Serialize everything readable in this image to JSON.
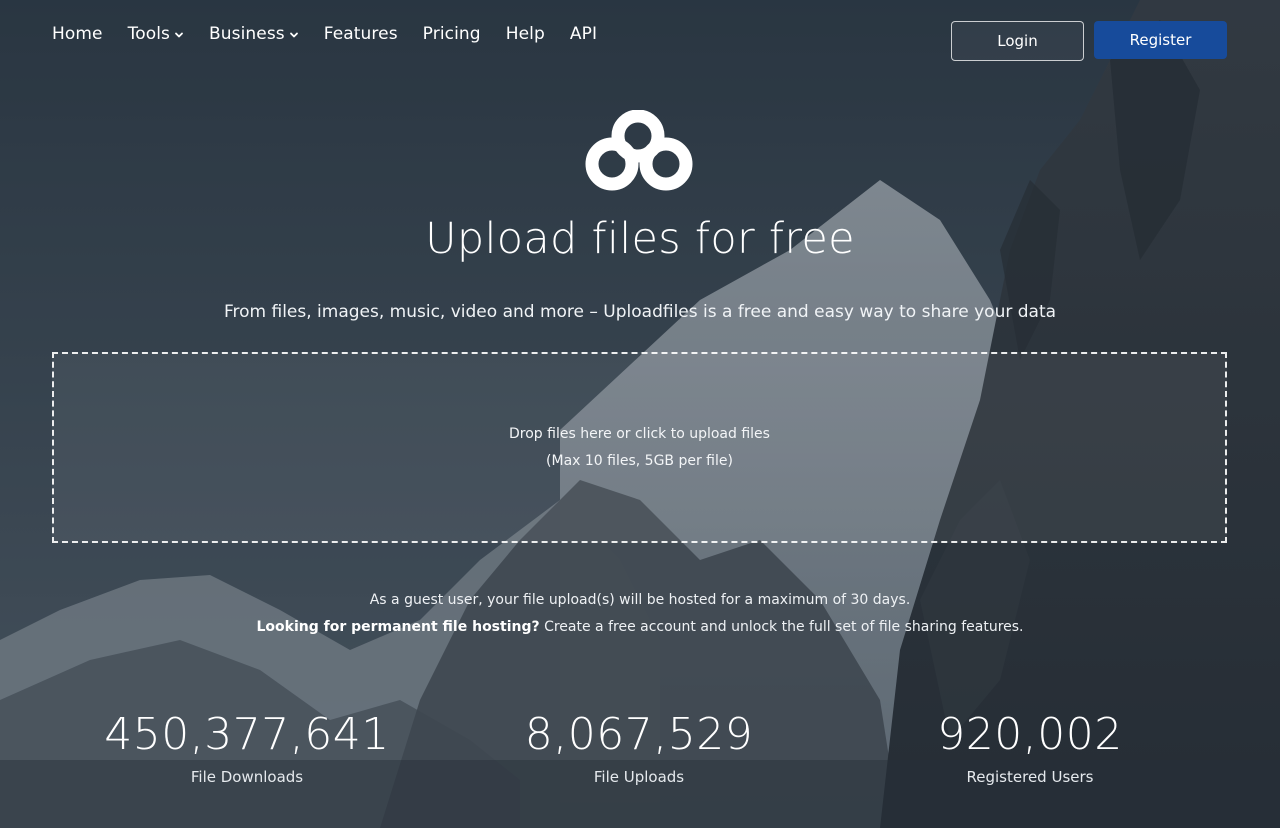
{
  "nav": {
    "items": [
      {
        "label": "Home",
        "dropdown": false
      },
      {
        "label": "Tools",
        "dropdown": true
      },
      {
        "label": "Business",
        "dropdown": true
      },
      {
        "label": "Features",
        "dropdown": false
      },
      {
        "label": "Pricing",
        "dropdown": false
      },
      {
        "label": "Help",
        "dropdown": false
      },
      {
        "label": "API",
        "dropdown": false
      }
    ]
  },
  "auth": {
    "login_label": "Login",
    "register_label": "Register"
  },
  "brand": {
    "logo_icon": "uploadfiles-logo-icon",
    "accent_color": "#174b9b"
  },
  "hero": {
    "title": "Upload files for free",
    "subtitle": "From files, images, music, video and more – Uploadfiles is a free and easy way to share your data"
  },
  "dropzone": {
    "main_text": "Drop files here or click to upload files",
    "limit_text": "(Max 10 files, 5GB per file)"
  },
  "guest_info": {
    "line1": "As a guest user, your file upload(s) will be hosted for a maximum of 30 days.",
    "line2_bold": "Looking for permanent file hosting?",
    "line2_rest": " Create a free account and unlock the full set of file sharing features."
  },
  "stats": [
    {
      "value": "450,377,641",
      "label": "File Downloads"
    },
    {
      "value": "8,067,529",
      "label": "File Uploads"
    },
    {
      "value": "920,002",
      "label": "Registered Users"
    }
  ]
}
